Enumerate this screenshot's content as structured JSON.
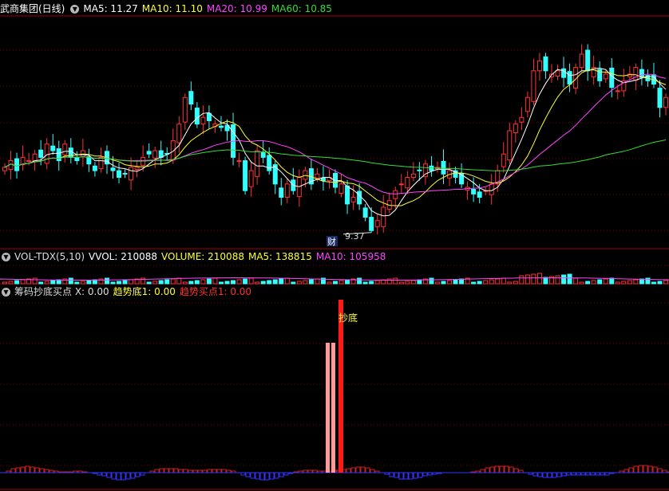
{
  "price_panel": {
    "title": "武商集团(日线)",
    "ma_labels": [
      {
        "text": "MA5: 11.27",
        "color": "#ffffff"
      },
      {
        "text": "MA10: 11.10",
        "color": "#ffff33"
      },
      {
        "text": "MA20: 10.99",
        "color": "#ff44ff"
      },
      {
        "text": "MA60: 10.85",
        "color": "#33dd33"
      }
    ],
    "low_marker": "9.37",
    "event_marker": "财"
  },
  "volume_panel": {
    "labels": [
      {
        "text": "VOL-TDX(5,10)",
        "color": "#dddddd"
      },
      {
        "text": "VVOL: 210088",
        "color": "#ffffff"
      },
      {
        "text": "VOLUME: 210088",
        "color": "#ffff33"
      },
      {
        "text": "MA5: 138815",
        "color": "#ffff33"
      },
      {
        "text": "MA10: 105958",
        "color": "#ff44ff"
      }
    ]
  },
  "indicator_panel": {
    "labels": [
      {
        "text": "筹码抄底买点 X: 0.00",
        "color": "#dddddd"
      },
      {
        "text": "趋势底1: 0.00",
        "color": "#ffff33"
      },
      {
        "text": "趋势买点1: 0.00",
        "color": "#ff3333"
      }
    ],
    "signal_label": "抄底"
  },
  "colors": {
    "up": "#ff3333",
    "down": "#33ffff",
    "grid": "#7a0000",
    "ma5": "#ffffff",
    "ma10": "#ffff33",
    "ma20": "#ff44ff",
    "ma60": "#33dd33"
  },
  "chart_data": {
    "type": "candlestick",
    "y_range": [
      9.2,
      12.6
    ],
    "min_low": 9.37,
    "closes": [
      10.35,
      10.45,
      10.3,
      10.5,
      10.45,
      10.55,
      10.5,
      10.7,
      10.6,
      10.45,
      10.7,
      10.5,
      10.45,
      10.6,
      10.4,
      10.3,
      10.5,
      10.4,
      10.3,
      10.2,
      10.25,
      10.35,
      10.35,
      10.5,
      10.55,
      10.6,
      10.5,
      10.55,
      10.75,
      11.0,
      11.4,
      11.3,
      11.0,
      11.1,
      11.05,
      11.0,
      10.95,
      10.9,
      10.5,
      10.45,
      10.0,
      10.3,
      10.6,
      10.5,
      10.3,
      10.1,
      9.9,
      10.1,
      10.0,
      10.2,
      10.3,
      10.1,
      10.25,
      10.15,
      10.2,
      10.05,
      10.1,
      9.8,
      9.9,
      9.8,
      9.6,
      9.4,
      9.55,
      9.75,
      9.85,
      10.0,
      10.1,
      10.2,
      10.25,
      10.3,
      10.4,
      10.3,
      10.35,
      10.25,
      10.3,
      10.2,
      10.1,
      10.05,
      9.95,
      9.9,
      10.0,
      10.1,
      10.3,
      10.55,
      10.9,
      11.0,
      11.1,
      11.4,
      11.8,
      11.95,
      11.8,
      11.75,
      11.8,
      11.7,
      11.6,
      11.85,
      12.05,
      11.8,
      11.85,
      11.65,
      11.75,
      11.55,
      11.5,
      11.65,
      11.75,
      11.85,
      11.7,
      11.65,
      11.6,
      11.25,
      11.4
    ]
  }
}
